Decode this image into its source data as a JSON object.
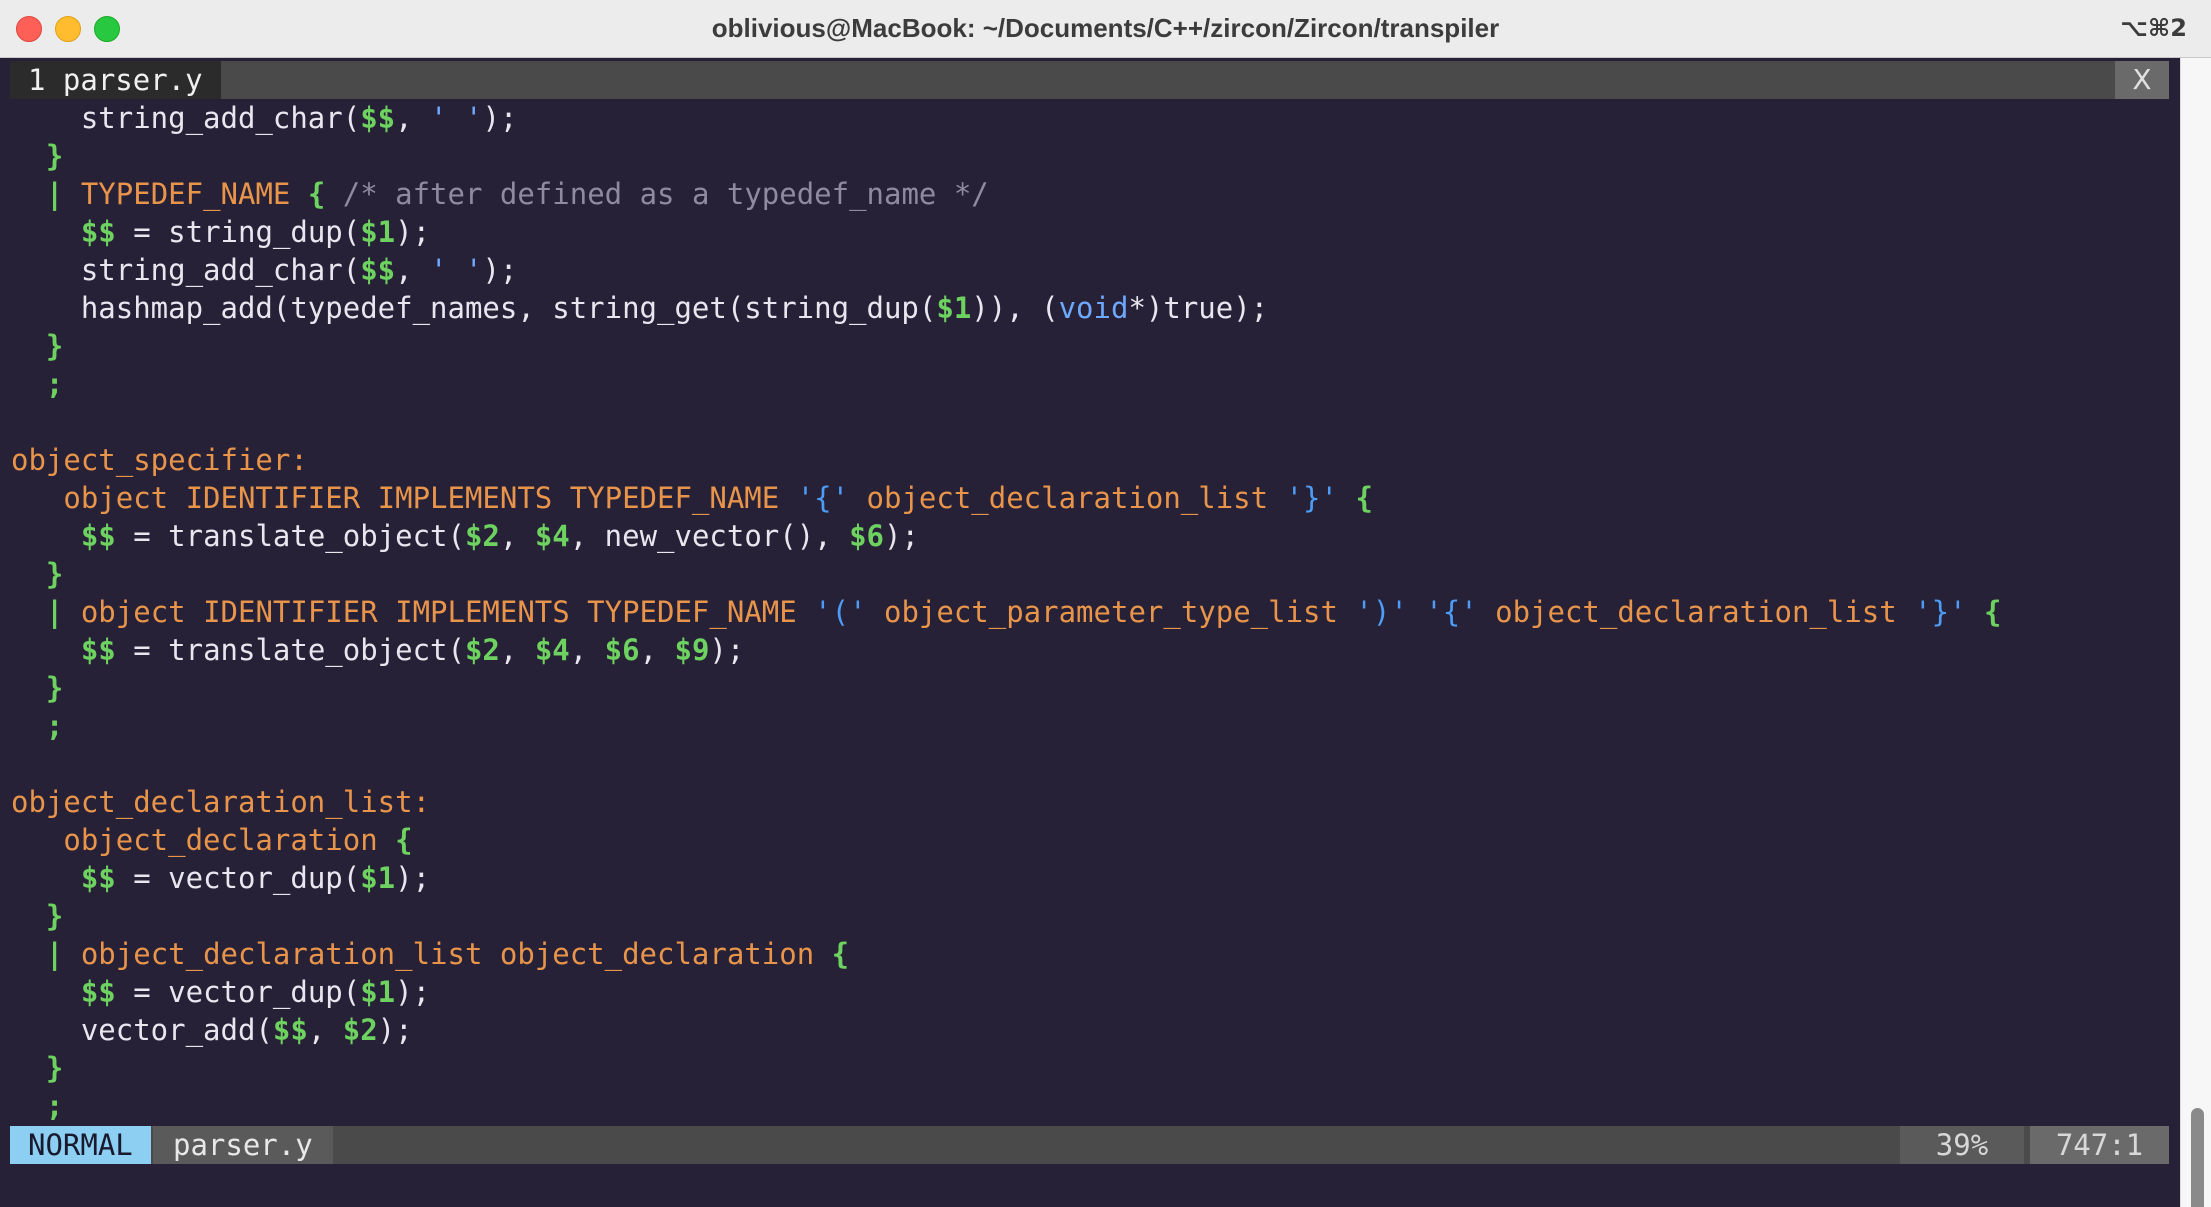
{
  "window": {
    "title": "oblivious@MacBook: ~/Documents/C++/zircon/Zircon/transpiler",
    "shortcut": "⌥⌘2"
  },
  "tabline": {
    "tab_label": "1 parser.y",
    "close_label": "X"
  },
  "code": {
    "lines": [
      [
        {
          "t": "    string_add_char(",
          "s": "n"
        },
        {
          "t": "$$",
          "s": "g"
        },
        {
          "t": ", ",
          "s": "n"
        },
        {
          "t": "' '",
          "s": "s"
        },
        {
          "t": ");",
          "s": "n"
        }
      ],
      [
        {
          "t": "  ",
          "s": "n"
        },
        {
          "t": "}",
          "s": "g"
        }
      ],
      [
        {
          "t": "  ",
          "s": "n"
        },
        {
          "t": "|",
          "s": "g"
        },
        {
          "t": " TYPEDEF_NAME ",
          "s": "k"
        },
        {
          "t": "{",
          "s": "g"
        },
        {
          "t": " /* after defined as a typedef_name */",
          "s": "c"
        }
      ],
      [
        {
          "t": "    ",
          "s": "n"
        },
        {
          "t": "$$",
          "s": "g"
        },
        {
          "t": " = string_dup(",
          "s": "n"
        },
        {
          "t": "$1",
          "s": "g"
        },
        {
          "t": ");",
          "s": "n"
        }
      ],
      [
        {
          "t": "    string_add_char(",
          "s": "n"
        },
        {
          "t": "$$",
          "s": "g"
        },
        {
          "t": ", ",
          "s": "n"
        },
        {
          "t": "' '",
          "s": "s"
        },
        {
          "t": ");",
          "s": "n"
        }
      ],
      [
        {
          "t": "    hashmap_add(typedef_names, string_get(string_dup(",
          "s": "n"
        },
        {
          "t": "$1",
          "s": "g"
        },
        {
          "t": ")), (",
          "s": "n"
        },
        {
          "t": "void",
          "s": "s"
        },
        {
          "t": "*)true);",
          "s": "n"
        }
      ],
      [
        {
          "t": "  ",
          "s": "n"
        },
        {
          "t": "}",
          "s": "g"
        }
      ],
      [
        {
          "t": "  ",
          "s": "n"
        },
        {
          "t": ";",
          "s": "g"
        }
      ],
      [],
      [
        {
          "t": "object_specifier:",
          "s": "k"
        }
      ],
      [
        {
          "t": "   object IDENTIFIER IMPLEMENTS TYPEDEF_NAME ",
          "s": "k"
        },
        {
          "t": "'{'",
          "s": "b"
        },
        {
          "t": " object_declaration_list ",
          "s": "k"
        },
        {
          "t": "'}'",
          "s": "b"
        },
        {
          "t": " ",
          "s": "n"
        },
        {
          "t": "{",
          "s": "g"
        }
      ],
      [
        {
          "t": "    ",
          "s": "n"
        },
        {
          "t": "$$",
          "s": "g"
        },
        {
          "t": " = translate_object(",
          "s": "n"
        },
        {
          "t": "$2",
          "s": "g"
        },
        {
          "t": ", ",
          "s": "n"
        },
        {
          "t": "$4",
          "s": "g"
        },
        {
          "t": ", new_vector(), ",
          "s": "n"
        },
        {
          "t": "$6",
          "s": "g"
        },
        {
          "t": ");",
          "s": "n"
        }
      ],
      [
        {
          "t": "  ",
          "s": "n"
        },
        {
          "t": "}",
          "s": "g"
        }
      ],
      [
        {
          "t": "  ",
          "s": "n"
        },
        {
          "t": "|",
          "s": "g"
        },
        {
          "t": " object IDENTIFIER IMPLEMENTS TYPEDEF_NAME ",
          "s": "k"
        },
        {
          "t": "'('",
          "s": "b"
        },
        {
          "t": " object_parameter_type_list ",
          "s": "k"
        },
        {
          "t": "')'",
          "s": "b"
        },
        {
          "t": " ",
          "s": "n"
        },
        {
          "t": "'{'",
          "s": "b"
        },
        {
          "t": " object_declaration_list ",
          "s": "k"
        },
        {
          "t": "'}'",
          "s": "b"
        },
        {
          "t": " ",
          "s": "n"
        },
        {
          "t": "{",
          "s": "g"
        }
      ],
      [
        {
          "t": "    ",
          "s": "n"
        },
        {
          "t": "$$",
          "s": "g"
        },
        {
          "t": " = translate_object(",
          "s": "n"
        },
        {
          "t": "$2",
          "s": "g"
        },
        {
          "t": ", ",
          "s": "n"
        },
        {
          "t": "$4",
          "s": "g"
        },
        {
          "t": ", ",
          "s": "n"
        },
        {
          "t": "$6",
          "s": "g"
        },
        {
          "t": ", ",
          "s": "n"
        },
        {
          "t": "$9",
          "s": "g"
        },
        {
          "t": ");",
          "s": "n"
        }
      ],
      [
        {
          "t": "  ",
          "s": "n"
        },
        {
          "t": "}",
          "s": "g"
        }
      ],
      [
        {
          "t": "  ",
          "s": "n"
        },
        {
          "t": ";",
          "s": "g"
        }
      ],
      [],
      [
        {
          "t": "object_declaration_list:",
          "s": "k"
        }
      ],
      [
        {
          "t": "   object_declaration ",
          "s": "k"
        },
        {
          "t": "{",
          "s": "g"
        }
      ],
      [
        {
          "t": "    ",
          "s": "n"
        },
        {
          "t": "$$",
          "s": "g"
        },
        {
          "t": " = vector_dup(",
          "s": "n"
        },
        {
          "t": "$1",
          "s": "g"
        },
        {
          "t": ");",
          "s": "n"
        }
      ],
      [
        {
          "t": "  ",
          "s": "n"
        },
        {
          "t": "}",
          "s": "g"
        }
      ],
      [
        {
          "t": "  ",
          "s": "n"
        },
        {
          "t": "|",
          "s": "g"
        },
        {
          "t": " object_declaration_list object_declaration ",
          "s": "k"
        },
        {
          "t": "{",
          "s": "g"
        }
      ],
      [
        {
          "t": "    ",
          "s": "n"
        },
        {
          "t": "$$",
          "s": "g"
        },
        {
          "t": " = vector_dup(",
          "s": "n"
        },
        {
          "t": "$1",
          "s": "g"
        },
        {
          "t": ");",
          "s": "n"
        }
      ],
      [
        {
          "t": "    vector_add(",
          "s": "n"
        },
        {
          "t": "$$",
          "s": "g"
        },
        {
          "t": ", ",
          "s": "n"
        },
        {
          "t": "$2",
          "s": "g"
        },
        {
          "t": ");",
          "s": "n"
        }
      ],
      [
        {
          "t": "  ",
          "s": "n"
        },
        {
          "t": "}",
          "s": "g"
        }
      ],
      [
        {
          "t": "  ",
          "s": "n"
        },
        {
          "t": ";",
          "s": "g"
        }
      ]
    ]
  },
  "statusline": {
    "mode": "NORMAL",
    "filename": "parser.y",
    "percent": "39%",
    "position": "747:1"
  },
  "scrollbar": {
    "position_fraction": 0.39
  },
  "colors": {
    "background": "#262136",
    "keyword": "#e8944a",
    "variable": "#6ed260",
    "comment": "#8f8aa0",
    "brace_literal": "#4d9df8",
    "mode_badge": "#8ccff3"
  }
}
